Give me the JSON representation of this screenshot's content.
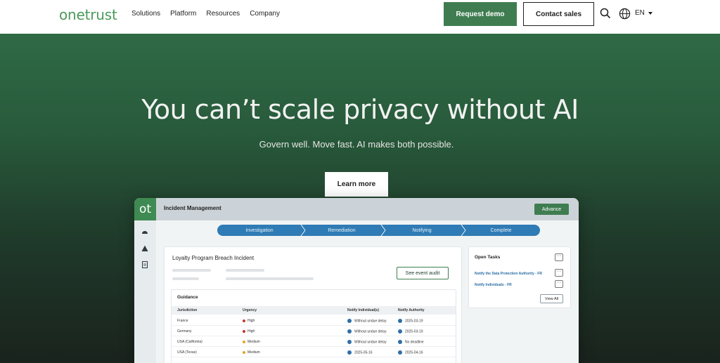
{
  "nav": {
    "logo": "onetrust",
    "links": [
      "Solutions",
      "Platform",
      "Resources",
      "Company"
    ],
    "request_demo": "Request demo",
    "contact_sales": "Contact sales",
    "language": "EN"
  },
  "hero": {
    "title": "You can’t scale privacy without AI",
    "subtitle": "Govern well. Move fast. AI makes both possible.",
    "cta": "Learn more"
  },
  "app": {
    "badge": "ot",
    "title": "Incident Management",
    "advance": "Advance",
    "steps": [
      "Investigation",
      "Remediation",
      "Notifying",
      "Complete"
    ],
    "incident": {
      "title": "Loyalty Program Breach Incident",
      "audit_button": "See event audit"
    },
    "guidance": {
      "title": "Guidance",
      "headers": [
        "Jurisdiction",
        "Urgency",
        "Notify Individual(s)",
        "Notify Authority"
      ],
      "rows": [
        {
          "jurisdiction": "France",
          "urgency": "High",
          "urgency_color": "#c0392b",
          "notify_individuals": "Without undue delay",
          "notify_authority": "2025-03-19"
        },
        {
          "jurisdiction": "Germany",
          "urgency": "High",
          "urgency_color": "#c0392b",
          "notify_individuals": "Without undue delay",
          "notify_authority": "2025-03-19"
        },
        {
          "jurisdiction": "USA (California)",
          "urgency": "Medium",
          "urgency_color": "#e0a526",
          "notify_individuals": "Without undue delay",
          "notify_authority": "No deadline"
        },
        {
          "jurisdiction": "USA (Texas)",
          "urgency": "Medium",
          "urgency_color": "#e0a526",
          "notify_individuals": "2025-05-16",
          "notify_authority": "2025-04-16"
        }
      ]
    },
    "open_tasks": {
      "title": "Open Tasks",
      "items": [
        "Notify the Data Protection Authority - FR",
        "Notify Individuals - FR"
      ],
      "view_all": "View All"
    }
  },
  "colors": {
    "brand_green": "#3f7d51",
    "step_blue": "#2f7bb5"
  }
}
